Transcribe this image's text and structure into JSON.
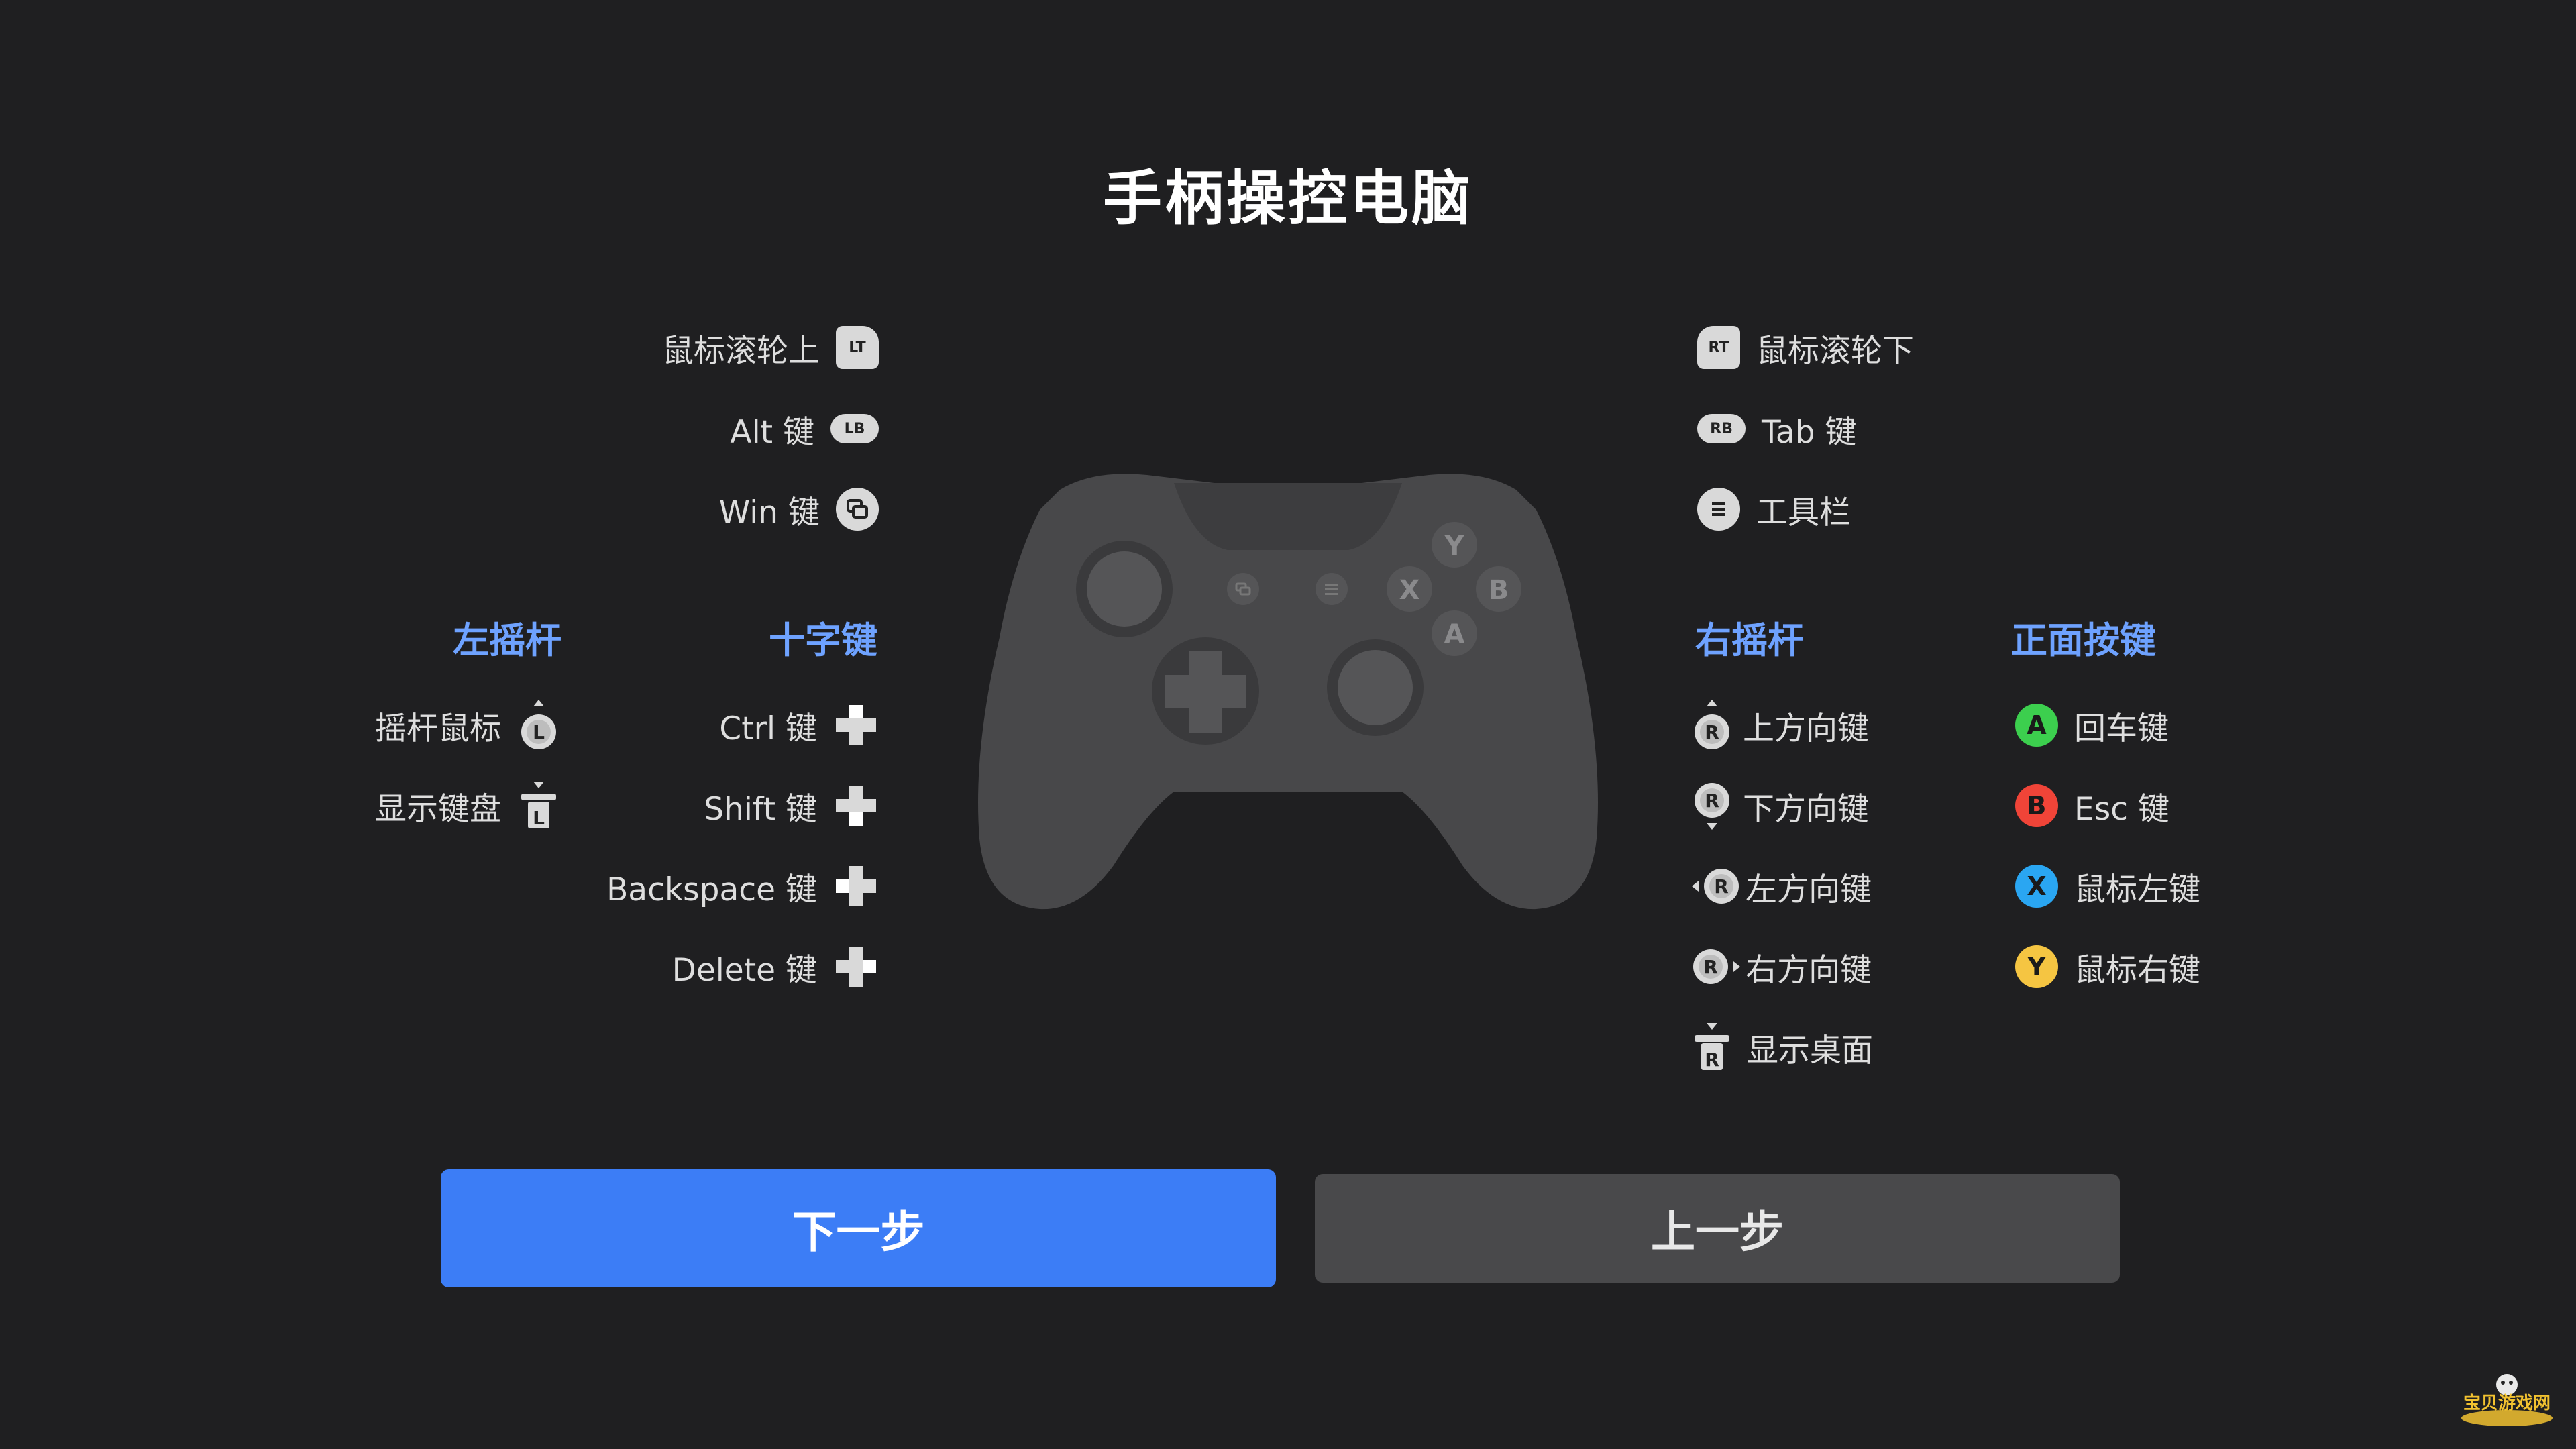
{
  "title": "手柄操控电脑",
  "colors": {
    "background": "#1f1f21",
    "accent": "#3c7df6",
    "heading": "#6ea2ff",
    "controller": "#48484a",
    "button_a": "#3ccf4e",
    "button_b": "#f04438",
    "button_x": "#2aa6f2",
    "button_y": "#f5c542"
  },
  "top_left": [
    {
      "label": "鼠标滚轮上",
      "icon": "lt-trigger-icon",
      "icon_text": "LT"
    },
    {
      "label": "Alt 键",
      "icon": "lb-bumper-icon",
      "icon_text": "LB"
    },
    {
      "label": "Win 键",
      "icon": "view-button-icon"
    }
  ],
  "top_right": [
    {
      "label": "鼠标滚轮下",
      "icon": "rt-trigger-icon",
      "icon_text": "RT"
    },
    {
      "label": "Tab 键",
      "icon": "rb-bumper-icon",
      "icon_text": "RB"
    },
    {
      "label": "工具栏",
      "icon": "menu-button-icon"
    }
  ],
  "left_stick": {
    "heading": "左摇杆",
    "items": [
      {
        "label": "摇杆鼠标",
        "icon": "left-stick-move-icon",
        "stick": "L"
      },
      {
        "label": "显示键盘",
        "icon": "left-stick-press-icon",
        "stick": "L"
      }
    ]
  },
  "dpad": {
    "heading": "十字键",
    "items": [
      {
        "label": "Ctrl 键",
        "icon": "dpad-up-icon"
      },
      {
        "label": "Shift 键",
        "icon": "dpad-down-icon"
      },
      {
        "label": "Backspace 键",
        "icon": "dpad-left-icon"
      },
      {
        "label": "Delete 键",
        "icon": "dpad-right-icon"
      }
    ]
  },
  "right_stick": {
    "heading": "右摇杆",
    "items": [
      {
        "label": "上方向键",
        "icon": "right-stick-up-icon",
        "stick": "R"
      },
      {
        "label": "下方向键",
        "icon": "right-stick-down-icon",
        "stick": "R"
      },
      {
        "label": "左方向键",
        "icon": "right-stick-left-icon",
        "stick": "R"
      },
      {
        "label": "右方向键",
        "icon": "right-stick-right-icon",
        "stick": "R"
      },
      {
        "label": "显示桌面",
        "icon": "right-stick-press-icon",
        "stick": "R"
      }
    ]
  },
  "face_buttons": {
    "heading": "正面按键",
    "items": [
      {
        "label": "回车键",
        "letter": "A"
      },
      {
        "label": "Esc 键",
        "letter": "B"
      },
      {
        "label": "鼠标左键",
        "letter": "X"
      },
      {
        "label": "鼠标右键",
        "letter": "Y"
      }
    ]
  },
  "controller_face_letters": [
    "Y",
    "X",
    "B",
    "A"
  ],
  "buttons": {
    "next": "下一步",
    "prev": "上一步"
  },
  "watermark": "宝贝游戏网"
}
